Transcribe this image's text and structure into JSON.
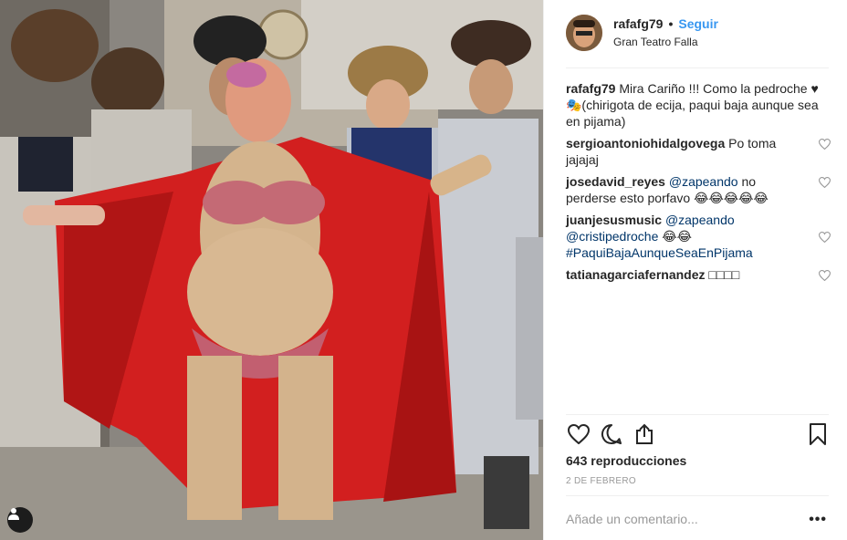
{
  "post": {
    "username": "rafafg79",
    "separator": "•",
    "follow_label": "Seguir",
    "location": "Gran Teatro Falla"
  },
  "caption": {
    "author": "rafafg79",
    "text": "Mira Cariño !!! Como la pedroche ♥ 🎭(chirigota de ecija, paqui baja aunque sea en pijama)"
  },
  "comments": [
    {
      "author": "sergioantoniohidalgovega",
      "text": "Po toma jajajaj",
      "mentions": []
    },
    {
      "author": "josedavid_reyes",
      "mention1": "@zapeando",
      "text": " no perderse esto porfavo 😂😂😂😂😂"
    },
    {
      "author": "juanjesusmusic",
      "mention1": "@zapeando",
      "mention2": "@cristipedroche",
      "text": " 😂😂",
      "hashtag": "#PaquiBajaAunqueSeaEnPijama"
    },
    {
      "author": "tatianagarciafernandez",
      "text": "□□□□"
    }
  ],
  "stats": {
    "views": "643 reproducciones",
    "date": "2 DE FEBRERO"
  },
  "composer": {
    "placeholder": "Añade un comentario...",
    "more": "•••"
  },
  "icons": {
    "like": "heart-icon",
    "comment": "comment-icon",
    "share": "share-icon",
    "save": "bookmark-icon",
    "user_tag": "user-icon"
  },
  "colors": {
    "link": "#3897f0",
    "mention": "#003569",
    "muted": "#999999",
    "text": "#262626"
  }
}
